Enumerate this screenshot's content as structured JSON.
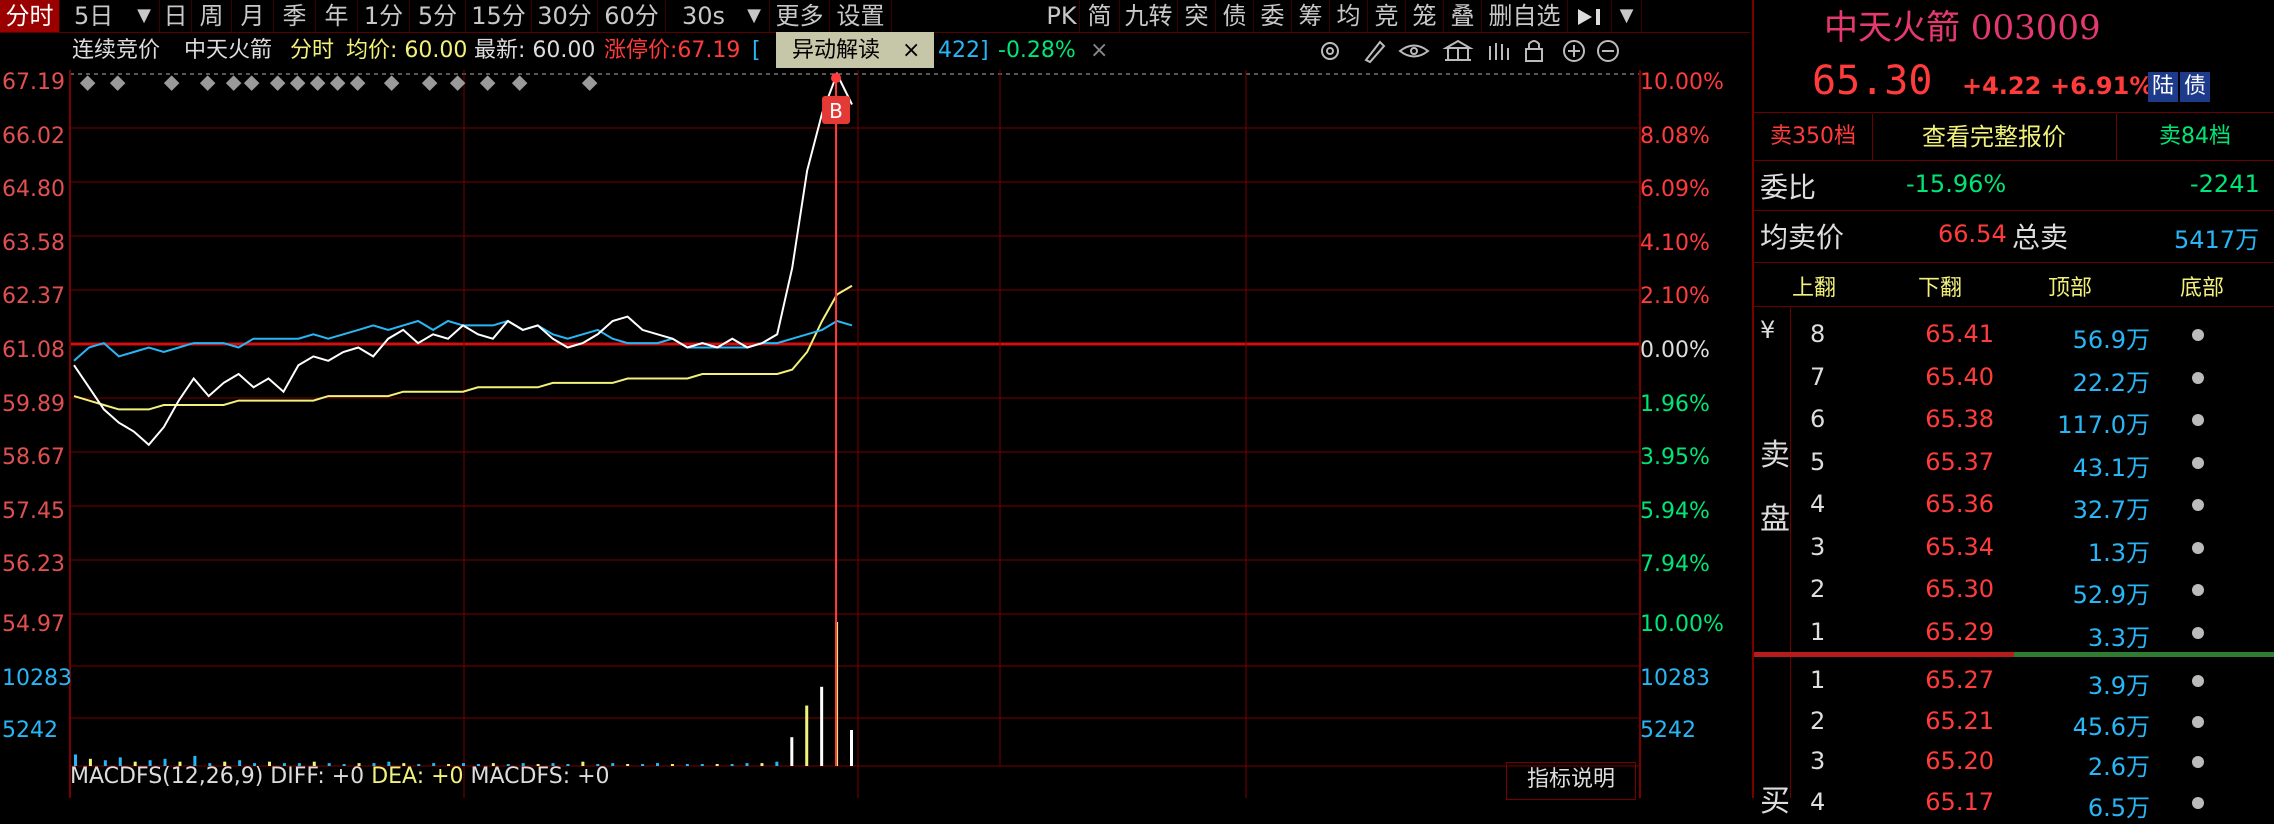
{
  "toolbar": {
    "items": [
      "分时",
      "5日",
      "日",
      "周",
      "月",
      "季",
      "年",
      "1分",
      "5分",
      "15分",
      "30分",
      "60分",
      "30s",
      "更多",
      "设置"
    ],
    "right_items": [
      "PK",
      "简",
      "九转",
      "突",
      "债",
      "委",
      "筹",
      "均",
      "竞",
      "笼",
      "叠",
      "删自选"
    ]
  },
  "infobar": {
    "auction": "连续竞价",
    "name": "中天火箭",
    "mode": "分时",
    "avg_label": "均价: 60.00",
    "latest_label": "最新: 60.00",
    "limit_label": "涨停价:67.19",
    "bracket_text": "[",
    "popup": "异动解读",
    "popup_close": "×",
    "vol_text": "422]",
    "chg_text": "-0.28%",
    "close_x": "×"
  },
  "chart_data": {
    "type": "line",
    "y_ticks_left": [
      "67.19",
      "66.02",
      "64.80",
      "63.58",
      "62.37",
      "61.08",
      "59.89",
      "58.67",
      "57.45",
      "56.23"
    ],
    "y_ticks_right": [
      "10.00%",
      "8.08%",
      "6.09%",
      "4.10%",
      "2.10%",
      "0.00%",
      "1.96%",
      "3.95%",
      "5.94%",
      "7.94%"
    ],
    "vol_ticks_left": [
      "54.97",
      "10283",
      "5242"
    ],
    "vol_ticks_right": [
      "10.00%",
      "10283",
      "5242"
    ],
    "ylim": [
      54.97,
      67.19
    ],
    "prev_close": 61.08,
    "marker_label": "B",
    "series": [
      {
        "values": [
          60.6,
          60.1,
          59.6,
          59.3,
          59.1,
          58.8,
          59.2,
          59.8,
          60.3,
          59.9,
          60.2,
          60.4,
          60.1,
          60.3,
          60.0,
          60.6,
          60.8,
          60.7,
          60.9,
          61.0,
          60.8,
          61.2,
          61.4,
          61.1,
          61.3,
          61.2,
          61.5,
          61.3,
          61.2,
          61.6,
          61.4,
          61.5,
          61.2,
          61.0,
          61.1,
          61.3,
          61.6,
          61.7,
          61.4,
          61.3,
          61.2,
          61.0,
          61.1,
          61.0,
          61.2,
          61.0,
          61.1,
          61.3,
          62.8,
          65.0,
          66.3,
          67.19,
          66.5
        ]
      },
      {
        "values": [
          60.7,
          61.0,
          61.1,
          60.8,
          60.9,
          61.0,
          60.9,
          61.0,
          61.1,
          61.1,
          61.1,
          61.0,
          61.2,
          61.2,
          61.2,
          61.2,
          61.3,
          61.2,
          61.3,
          61.4,
          61.5,
          61.4,
          61.5,
          61.6,
          61.4,
          61.6,
          61.5,
          61.5,
          61.5,
          61.6,
          61.4,
          61.5,
          61.3,
          61.2,
          61.3,
          61.4,
          61.2,
          61.1,
          61.1,
          61.1,
          61.2,
          61.0,
          61.0,
          61.0,
          61.0,
          61.0,
          61.1,
          61.1,
          61.2,
          61.3,
          61.4,
          61.6,
          61.5
        ]
      },
      {
        "values": [
          59.9,
          59.8,
          59.7,
          59.6,
          59.6,
          59.6,
          59.7,
          59.7,
          59.7,
          59.7,
          59.7,
          59.8,
          59.8,
          59.8,
          59.8,
          59.8,
          59.8,
          59.9,
          59.9,
          59.9,
          59.9,
          59.9,
          60.0,
          60.0,
          60.0,
          60.0,
          60.0,
          60.1,
          60.1,
          60.1,
          60.1,
          60.1,
          60.2,
          60.2,
          60.2,
          60.2,
          60.2,
          60.3,
          60.3,
          60.3,
          60.3,
          60.3,
          60.4,
          60.4,
          60.4,
          60.4,
          60.4,
          60.4,
          60.5,
          60.9,
          61.6,
          62.2,
          62.4
        ]
      }
    ],
    "volume": [
      0.08,
      0.05,
      0.04,
      0.06,
      0.03,
      0.04,
      0.05,
      0.03,
      0.07,
      0.02,
      0.03,
      0.04,
      0.02,
      0.03,
      0.02,
      0.02,
      0.03,
      0.02,
      0.01,
      0.02,
      0.02,
      0.03,
      0.02,
      0.01,
      0.02,
      0.01,
      0.02,
      0.01,
      0.02,
      0.01,
      0.02,
      0.01,
      0.02,
      0.01,
      0.03,
      0.01,
      0.02,
      0.01,
      0.01,
      0.02,
      0.01,
      0.01,
      0.01,
      0.01,
      0.01,
      0.02,
      0.02,
      0.03,
      0.2,
      0.42,
      0.55,
      1.0,
      0.25
    ]
  },
  "macd": {
    "text": "MACDFS(12,26,9) DIFF: +0",
    "dea": "DEA: +0",
    "macdfs": "MACDFS: +0"
  },
  "indicator_btn": "指标说明",
  "panel": {
    "title": "中天火箭 003009",
    "price": "65.30",
    "change": "+4.22",
    "change_pct": "+6.91%",
    "tags": [
      "陆",
      "债"
    ],
    "sell_levels_btn": "卖350档",
    "full_quote_btn": "查看完整报价",
    "buy_levels_btn": "卖84档",
    "weibi_label": "委比",
    "weibi_pct": "-15.96%",
    "weibi_val": "-2241",
    "avg_sell_label": "均卖价",
    "avg_sell_val": "66.54",
    "total_sell_label": "总卖",
    "total_sell_val": "5417万",
    "tabs": [
      "上翻",
      "下翻",
      "顶部",
      "底部"
    ],
    "yen": "¥",
    "sell_side": "卖盘",
    "buy_side": "买",
    "asks": [
      {
        "lvl": "8",
        "price": "65.41",
        "vol": "56.9万"
      },
      {
        "lvl": "7",
        "price": "65.40",
        "vol": "22.2万"
      },
      {
        "lvl": "6",
        "price": "65.38",
        "vol": "117.0万"
      },
      {
        "lvl": "5",
        "price": "65.37",
        "vol": "43.1万"
      },
      {
        "lvl": "4",
        "price": "65.36",
        "vol": "32.7万"
      },
      {
        "lvl": "3",
        "price": "65.34",
        "vol": "1.3万"
      },
      {
        "lvl": "2",
        "price": "65.30",
        "vol": "52.9万"
      },
      {
        "lvl": "1",
        "price": "65.29",
        "vol": "3.3万"
      }
    ],
    "bids": [
      {
        "lvl": "1",
        "price": "65.27",
        "vol": "3.9万"
      },
      {
        "lvl": "2",
        "price": "65.21",
        "vol": "45.6万"
      },
      {
        "lvl": "3",
        "price": "65.20",
        "vol": "2.6万"
      },
      {
        "lvl": "4",
        "price": "65.17",
        "vol": "6.5万"
      }
    ]
  },
  "colors": {
    "red": "#ff3b3b",
    "green": "#00e676",
    "cyan": "#29b6f6",
    "yellow": "#f2f27a",
    "grid": "#7a0000"
  }
}
